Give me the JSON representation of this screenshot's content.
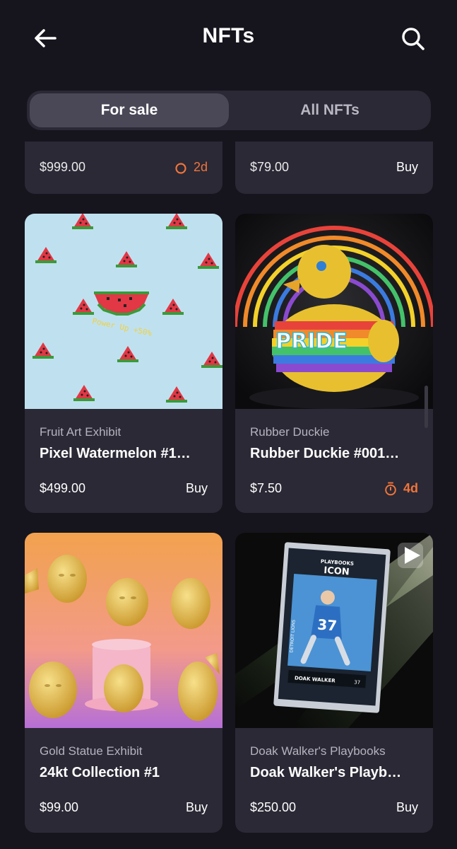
{
  "header": {
    "title": "NFTs",
    "back_icon": "arrow-left-icon",
    "search_icon": "search-icon"
  },
  "tabs": [
    {
      "label": "For sale",
      "active": true
    },
    {
      "label": "All NFTs",
      "active": false
    }
  ],
  "partial_row": [
    {
      "price": "$999.00",
      "time_left": "2d"
    },
    {
      "price": "$79.00",
      "action": "Buy"
    }
  ],
  "cards": [
    {
      "collection": "Fruit Art Exhibit",
      "name": "Pixel Watermelon #1…",
      "price": "$499.00",
      "action": "Buy"
    },
    {
      "collection": "Rubber Duckie",
      "name": "Rubber Duckie #001…",
      "price": "$7.50",
      "time_left": "4d"
    },
    {
      "collection": "Gold Statue Exhibit",
      "name": "24kt Collection #1",
      "price": "$99.00",
      "action": "Buy"
    },
    {
      "collection": "Doak Walker's Playbooks",
      "name": "Doak Walker's Playb…",
      "price": "$250.00",
      "action": "Buy"
    }
  ],
  "artwork": {
    "watermelon_caption": "Power Up +50%",
    "duckie_sign": "PRIDE",
    "card_title_top": "PLAYBOOKS",
    "card_title": "ICON",
    "card_player": "DOAK WALKER",
    "card_number": "37",
    "card_team": "DETROIT LIONS"
  },
  "colors": {
    "background": "#16151d",
    "card": "#2a2935",
    "accent_orange": "#f0743b",
    "segment_active": "#4a4857"
  }
}
